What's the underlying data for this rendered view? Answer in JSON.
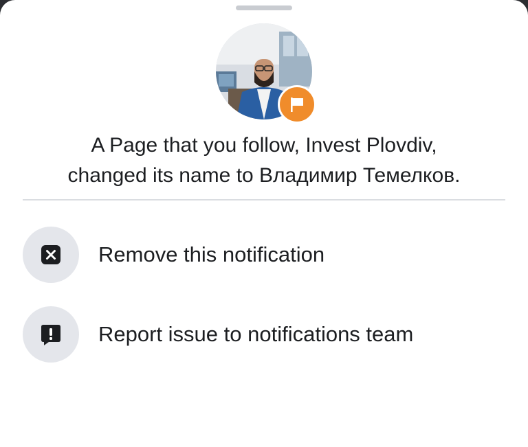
{
  "notification": {
    "avatar_icon": "profile-photo",
    "badge_icon": "flag-icon",
    "message_line1": "A Page that you follow, Invest Plovdiv,",
    "message_line2": "changed its name to Владимир Темелков."
  },
  "actions": [
    {
      "icon": "close-square-icon",
      "label": "Remove this notification"
    },
    {
      "icon": "report-speech-icon",
      "label": "Report issue to notifications team"
    }
  ],
  "colors": {
    "badge": "#f08c2b",
    "text": "#1c1e21",
    "icon_bg": "#e4e6eb",
    "divider": "#dadde1"
  }
}
